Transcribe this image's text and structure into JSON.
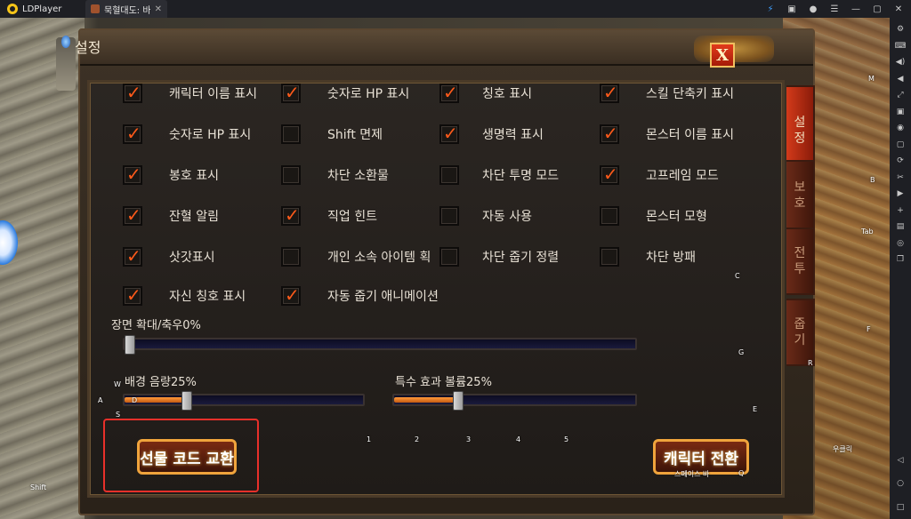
{
  "titlebar": {
    "app_name": "LDPlayer",
    "tab_label": "묵혈대도: 바...",
    "tab_close": "✕",
    "icons": [
      "bolt-icon",
      "gift-icon",
      "user-icon",
      "menu-icon",
      "minimize-icon",
      "maximize-icon",
      "close-icon"
    ],
    "icon_glyphs": [
      "⚡",
      "▣",
      "●",
      "☰",
      "—",
      "▢",
      "✕"
    ]
  },
  "dialog": {
    "title": "설정",
    "close_label": "X",
    "tabs": [
      {
        "label": "설\n정",
        "active": true
      },
      {
        "label": "보\n호",
        "active": false
      },
      {
        "label": "전\n투",
        "active": false
      },
      {
        "label": "줍\n기",
        "active": false
      }
    ],
    "options": [
      {
        "label": "캐릭터 이름 표시",
        "checked": true
      },
      {
        "label": "숫자로 HP 표시",
        "checked": true
      },
      {
        "label": "칭호 표시",
        "checked": true
      },
      {
        "label": "스킬 단축키 표시",
        "checked": true
      },
      {
        "label": "숫자로 HP 표시",
        "checked": true
      },
      {
        "label": "Shift  면제",
        "checked": false
      },
      {
        "label": "생명력 표시",
        "checked": true
      },
      {
        "label": "몬스터 이름 표시",
        "checked": true
      },
      {
        "label": "봉호 표시",
        "checked": true
      },
      {
        "label": "차단 소환물",
        "checked": false
      },
      {
        "label": "차단 투명 모드",
        "checked": false
      },
      {
        "label": "고프레임 모드",
        "checked": true
      },
      {
        "label": "잔혈 알림",
        "checked": true
      },
      {
        "label": "직업 힌트",
        "checked": true
      },
      {
        "label": "자동 사용",
        "checked": false
      },
      {
        "label": "몬스터 모형",
        "checked": false
      },
      {
        "label": "삿갓표시",
        "checked": true
      },
      {
        "label": "개인 소속 아이템 획",
        "checked": false
      },
      {
        "label": "차단 줍기 정렬",
        "checked": false
      },
      {
        "label": "차단 방패",
        "checked": false
      },
      {
        "label": "자신 칭호 표시",
        "checked": true
      },
      {
        "label": "자동 줍기 애니메이션",
        "checked": true
      }
    ],
    "zoom": {
      "label": "장면 확대/축우0%",
      "value": 0
    },
    "bgm": {
      "label": "배경 음량25%",
      "value": 25
    },
    "sfx": {
      "label": "특수 효과 볼륨25%",
      "value": 25
    },
    "gift_code_button": "선물 코드 교환",
    "switch_char_button": "캐릭터 전환"
  },
  "keymap": {
    "m": "M",
    "b": "B",
    "tab": "Tab",
    "f": "F",
    "r": "R",
    "c": "C",
    "g": "G",
    "e": "E",
    "q": "Q",
    "w": "W",
    "a": "A",
    "s": "S",
    "d": "D",
    "shift": "Shift",
    "n1": "1",
    "n2": "2",
    "n3": "3",
    "n4": "4",
    "n5": "5",
    "right_click": "우클릭",
    "space": "스페이스 바"
  },
  "sidebar_icons": [
    "settings-icon",
    "keyboard-icon",
    "volume-up-icon",
    "volume-down-icon",
    "fullscreen-icon",
    "lock-icon",
    "record-icon",
    "screenshot-icon",
    "sync-icon",
    "scissors-icon",
    "video-icon",
    "add-icon",
    "folder-icon",
    "location-icon",
    "copy-icon"
  ],
  "sidebar_glyphs": [
    "⚙",
    "⌨",
    "◀)",
    "◀",
    "⤢",
    "▣",
    "◉",
    "▢",
    "⟳",
    "✂",
    "▶",
    "+",
    "▤",
    "◎",
    "❐"
  ],
  "colors": {
    "checkmark": "#ff5a1a",
    "highlight": "#e8302a",
    "active_tab": "#d33a1a"
  }
}
